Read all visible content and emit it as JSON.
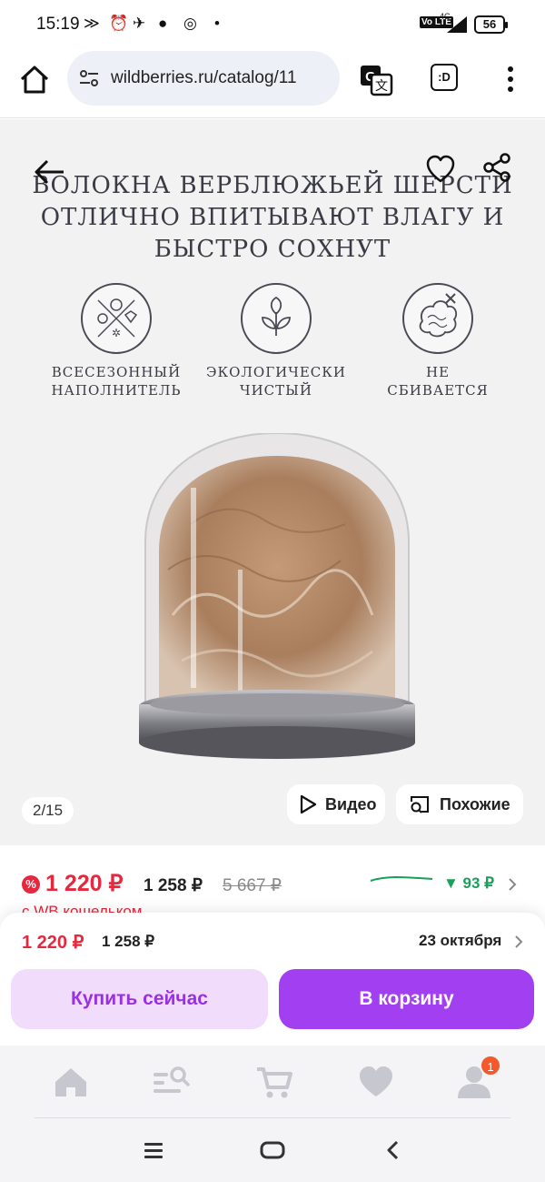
{
  "status_bar": {
    "time": "15:19",
    "battery": "56",
    "network": "4G"
  },
  "browser": {
    "url": "wildberries.ru/catalog/11",
    "tab_icon_label": ":D"
  },
  "gallery": {
    "headline_lines": [
      "ВОЛОКНА ВЕРБЛЮЖЬЕЙ ШЕРСТИ",
      "ОТЛИЧНО ВПИТЫВАЮТ ВЛАГУ И",
      "БЫСТРО СОХНУТ"
    ],
    "features": [
      {
        "label_line1": "ВСЕСЕЗОННЫЙ",
        "label_line2": "НАПОЛНИТЕЛЬ",
        "icon": "seasons-icon"
      },
      {
        "label_line1": "ЭКОЛОГИЧЕСКИ",
        "label_line2": "ЧИСТЫЙ",
        "icon": "leaf-icon"
      },
      {
        "label_line1": "НЕ",
        "label_line2": "СБИВАЕТСЯ",
        "icon": "wool-ball-icon"
      }
    ],
    "counter": "2/15",
    "video_label": "Видео",
    "similar_label": "Похожие"
  },
  "price": {
    "main": "1 220 ₽",
    "second": "1 258 ₽",
    "old": "5 667 ₽",
    "trend_drop": "▼ 93 ₽",
    "wallet_note": "с WB кошельком",
    "accent_color": "#e5283e",
    "trend_color": "#1b9e5a"
  },
  "buy_sheet": {
    "price": "1 220 ₽",
    "price_second": "1 258 ₽",
    "delivery_date": "23 октября",
    "buy_now_label": "Купить сейчас",
    "cart_label": "В корзину",
    "brand_color": "#a23ff0"
  },
  "app_nav": {
    "items": [
      "home-icon",
      "catalog-search-icon",
      "cart-icon",
      "favorites-icon",
      "profile-icon"
    ],
    "profile_badge": "1"
  },
  "system_nav": {
    "items": [
      "recent-apps-icon",
      "home-pill-icon",
      "back-icon"
    ]
  }
}
